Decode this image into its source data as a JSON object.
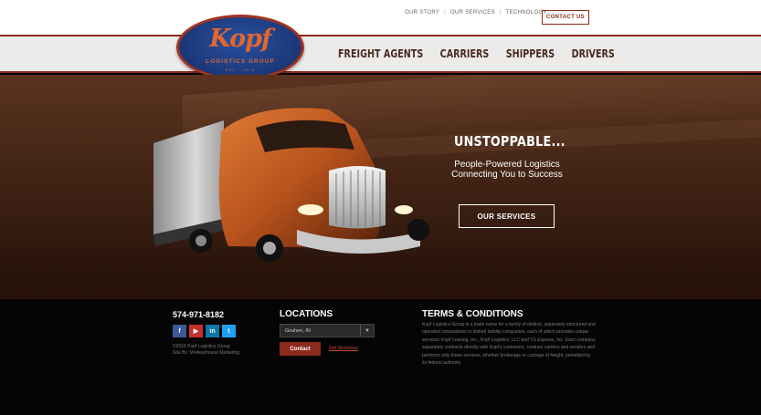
{
  "header": {
    "utility_nav": [
      "OUR STORY",
      "OUR SERVICES",
      "TECHNOLOGY"
    ],
    "contact_label": "CONTACT US",
    "main_nav": [
      "FREIGHT AGENTS",
      "CARRIERS",
      "SHIPPERS",
      "DRIVERS"
    ],
    "logo": {
      "script": "Kopf",
      "sub": "LOGISTICS GROUP",
      "est": "EST. · 1976"
    }
  },
  "hero": {
    "title": "UNSTOPPABLE...",
    "subtitle_line1": "People-Powered Logistics",
    "subtitle_line2": "Connecting You to Success",
    "cta_label": "OUR SERVICES"
  },
  "footer": {
    "phone": "574-971-8182",
    "socials": [
      {
        "icon": "facebook-icon",
        "glyph": "f",
        "color": "#3b5998"
      },
      {
        "icon": "youtube-icon",
        "glyph": "▶",
        "color": "#c4302b"
      },
      {
        "icon": "linkedin-icon",
        "glyph": "in",
        "color": "#0e76a8"
      },
      {
        "icon": "twitter-icon",
        "glyph": "t",
        "color": "#1da1f2"
      }
    ],
    "copyright": "©2016 Kopf Logistics Group",
    "credit": "Site By: Monkeyhouse Marketing",
    "locations_heading": "LOCATIONS",
    "location_selected": "Goshen, IN",
    "contact_label": "Contact",
    "directions_label": "Get Directions",
    "terms_heading": "TERMS & CONDITIONS",
    "terms_text": "Kopf Logistics Group is a trade name for a family of distinct, separately structured and operated corporations or limited liability companies, each of which provides unique services: Kopf Leasing, Inc., Kopf Logistics, LLC and TG Express, Inc. Each company separately contracts directly with Kopf's customers, contract carriers and vendors and performs only those services, whether brokerage or carriage of freight, permitted by its federal authority."
  },
  "colors": {
    "brand_red": "#8c2a1c",
    "brand_blue": "#1b3777",
    "brand_orange": "#e0682f"
  }
}
